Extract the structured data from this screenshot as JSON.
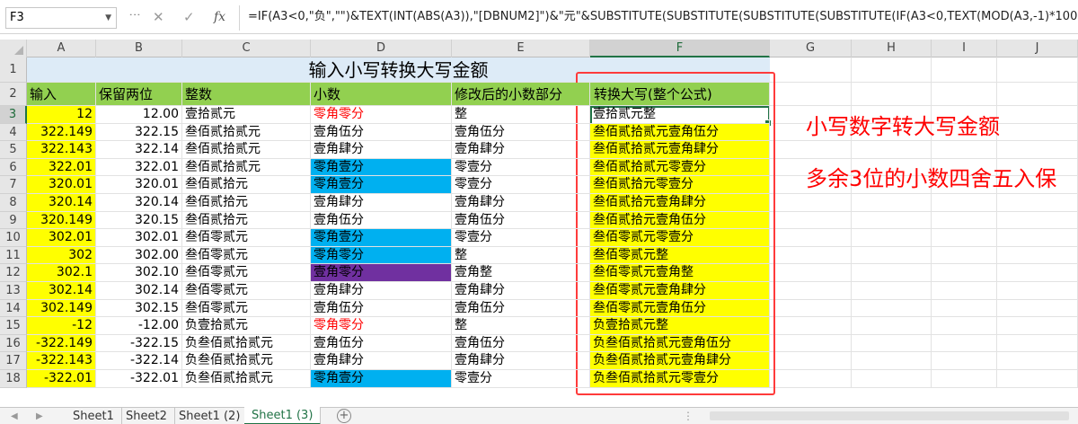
{
  "formula_bar": {
    "name_box": "F3",
    "cancel_icon": "✕",
    "enter_icon": "✓",
    "fx_label": "fx",
    "formula": "=IF(A3<0,\"负\",\"\")&TEXT(INT(ABS(A3)),\"[DBNUM2]\")&\"元\"&SUBSTITUTE(SUBSTITUTE(SUBSTITUTE(SUBSTITUTE(IF(A3<0,TEXT(MOD(A3,-1)*100,"
  },
  "columns": [
    "A",
    "B",
    "C",
    "D",
    "E",
    "F",
    "G",
    "H",
    "I",
    "J"
  ],
  "selected_column": "F",
  "selected_row": "3",
  "title": "输入小写转换大写金额",
  "headers": [
    "输入",
    "保留两位",
    "整数",
    "小数",
    "修改后的小数部分",
    "转换大写(整个公式)"
  ],
  "rows": [
    {
      "row": "3",
      "a": "12",
      "b": "12.00",
      "c": "壹拾贰元",
      "d": "零角零分",
      "e": "整",
      "f": "壹拾贰元整"
    },
    {
      "row": "4",
      "a": "322.149",
      "b": "322.15",
      "c": "叁佰贰拾贰元",
      "d": "壹角伍分",
      "e": "壹角伍分",
      "f": "叁佰贰拾贰元壹角伍分"
    },
    {
      "row": "5",
      "a": "322.143",
      "b": "322.14",
      "c": "叁佰贰拾贰元",
      "d": "壹角肆分",
      "e": "壹角肆分",
      "f": "叁佰贰拾贰元壹角肆分"
    },
    {
      "row": "6",
      "a": "322.01",
      "b": "322.01",
      "c": "叁佰贰拾贰元",
      "d": "零角壹分",
      "e": "零壹分",
      "f": "叁佰贰拾贰元零壹分"
    },
    {
      "row": "7",
      "a": "320.01",
      "b": "320.01",
      "c": "叁佰贰拾元",
      "d": "零角壹分",
      "e": "零壹分",
      "f": "叁佰贰拾元零壹分"
    },
    {
      "row": "8",
      "a": "320.14",
      "b": "320.14",
      "c": "叁佰贰拾元",
      "d": "壹角肆分",
      "e": "壹角肆分",
      "f": "叁佰贰拾元壹角肆分"
    },
    {
      "row": "9",
      "a": "320.149",
      "b": "320.15",
      "c": "叁佰贰拾元",
      "d": "壹角伍分",
      "e": "壹角伍分",
      "f": "叁佰贰拾元壹角伍分"
    },
    {
      "row": "10",
      "a": "302.01",
      "b": "302.01",
      "c": "叁佰零贰元",
      "d": "零角壹分",
      "e": "零壹分",
      "f": "叁佰零贰元零壹分"
    },
    {
      "row": "11",
      "a": "302",
      "b": "302.00",
      "c": "叁佰零贰元",
      "d": "零角零分",
      "e": "整",
      "f": "叁佰零贰元整"
    },
    {
      "row": "12",
      "a": "302.1",
      "b": "302.10",
      "c": "叁佰零贰元",
      "d": "壹角零分",
      "e": "壹角整",
      "f": "叁佰零贰元壹角整"
    },
    {
      "row": "13",
      "a": "302.14",
      "b": "302.14",
      "c": "叁佰零贰元",
      "d": "壹角肆分",
      "e": "壹角肆分",
      "f": "叁佰零贰元壹角肆分"
    },
    {
      "row": "14",
      "a": "302.149",
      "b": "302.15",
      "c": "叁佰零贰元",
      "d": "壹角伍分",
      "e": "壹角伍分",
      "f": "叁佰零贰元壹角伍分"
    },
    {
      "row": "15",
      "a": "-12",
      "b": "-12.00",
      "c": "负壹拾贰元",
      "d": "零角零分",
      "e": "整",
      "f": "负壹拾贰元整"
    },
    {
      "row": "16",
      "a": "-322.149",
      "b": "-322.15",
      "c": "负叁佰贰拾贰元",
      "d": "壹角伍分",
      "e": "壹角伍分",
      "f": "负叁佰贰拾贰元壹角伍分"
    },
    {
      "row": "17",
      "a": "-322.143",
      "b": "-322.14",
      "c": "负叁佰贰拾贰元",
      "d": "壹角肆分",
      "e": "壹角肆分",
      "f": "负叁佰贰拾贰元壹角肆分"
    },
    {
      "row": "18",
      "a": "-322.01",
      "b": "-322.01",
      "c": "负叁佰贰拾贰元",
      "d": "零角壹分",
      "e": "零壹分",
      "f": "负叁佰贰拾贰元零壹分"
    }
  ],
  "annotations": [
    "小写数字转大写金额",
    "多余3位的小数四舍五入保"
  ],
  "sheet_tabs": [
    "Sheet1",
    "Sheet2",
    "Sheet1 (2)",
    "Sheet1 (3)"
  ],
  "active_tab": "Sheet1 (3)",
  "colors": {
    "yellow": "#ffff00",
    "green": "#92d050",
    "cyan": "#00b0f0",
    "purple": "#7030a0",
    "red": "#ff0000",
    "excel_green": "#217346"
  }
}
